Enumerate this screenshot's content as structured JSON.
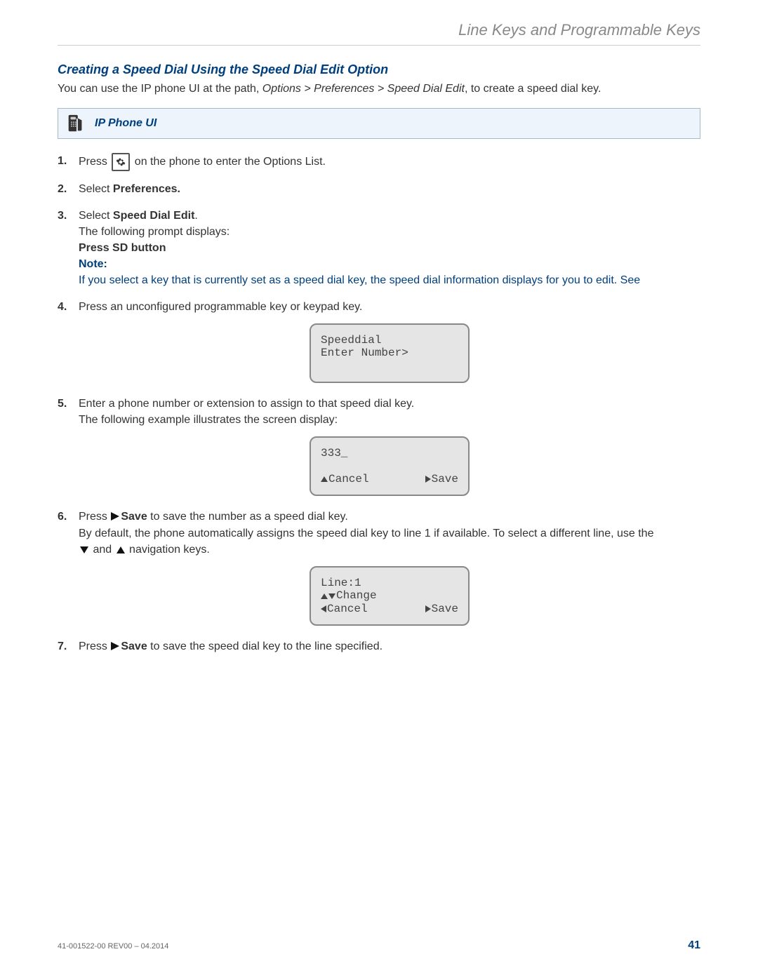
{
  "header": "Line Keys and Programmable Keys",
  "heading": "Creating a Speed Dial Using the Speed Dial Edit Option",
  "intro": {
    "prefix": "You can use the IP phone UI at the path, ",
    "path": "Options > Preferences > Speed Dial Edit",
    "suffix": ", to create a speed dial key."
  },
  "callout": {
    "title": "IP Phone UI"
  },
  "steps": {
    "s1": {
      "press": "Press ",
      "after": " on the phone to enter the Options List."
    },
    "s2": {
      "select": "Select ",
      "prefs": "Preferences."
    },
    "s3": {
      "select": "Select ",
      "sde": "Speed Dial Edit",
      "period": ".",
      "prompt": "The following prompt displays:",
      "sdbtn": "Press SD button",
      "noteLabel": "Note:",
      "noteText": "If you select a key that is currently set as a speed dial key, the speed dial information displays for you to edit. See"
    },
    "s4": {
      "text": "Press an unconfigured programmable key or keypad key."
    },
    "screen1": {
      "l1": "Speeddial",
      "l2": "Enter Number>"
    },
    "s5": {
      "l1": "Enter a phone number or extension to assign to that speed dial key.",
      "l2": "The following example illustrates the screen display:"
    },
    "screen2": {
      "num": "333_",
      "cancel": "Cancel",
      "save": "Save"
    },
    "s6": {
      "press": "Press ",
      "save": "Save",
      "after": " to save the number as a speed dial key.",
      "l2a": "By default, the phone automatically assigns the speed dial key to line 1 if available. To select a different line, use the",
      "l2b": " and ",
      "l2c": " navigation keys."
    },
    "screen3": {
      "line": "Line:1",
      "change": "Change",
      "cancel": "Cancel",
      "save": "Save"
    },
    "s7": {
      "press": "Press ",
      "save": "Save",
      "after": " to save the speed dial key to the line specified."
    }
  },
  "footer": {
    "rev": "41-001522-00 REV00 – 04.2014",
    "page": "41"
  }
}
